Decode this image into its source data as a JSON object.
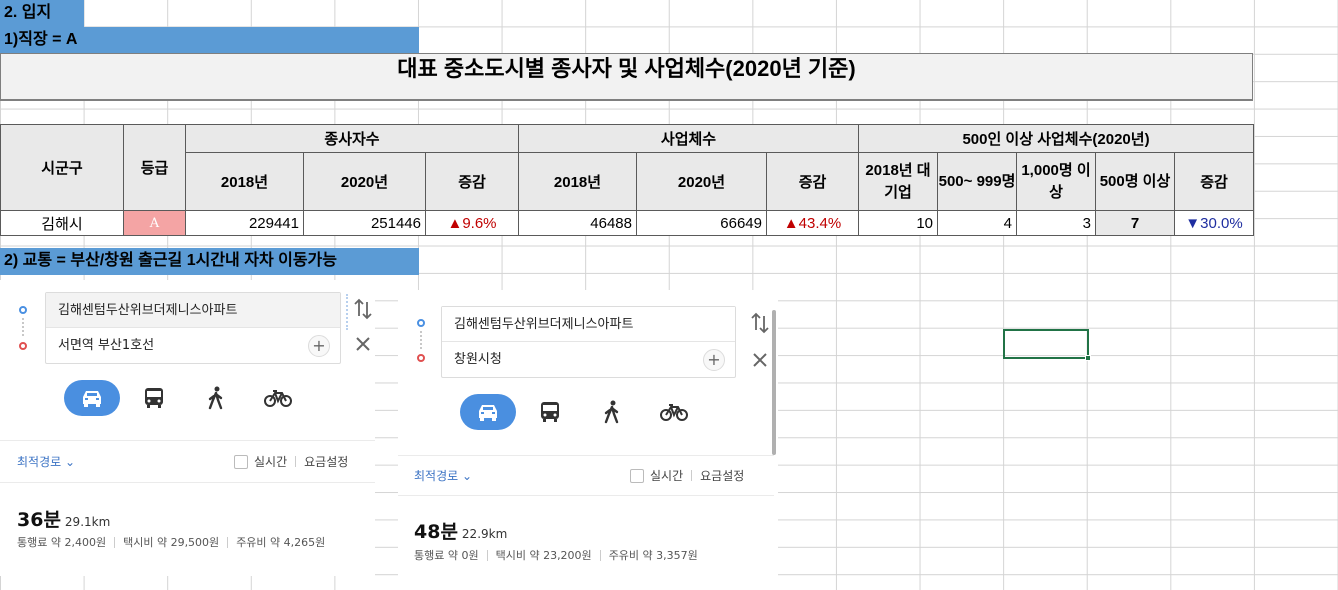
{
  "sheet": {
    "section_title": "2. 입지",
    "sub1_title": "1)직장 = A",
    "sub2_title": "2) 교통 = 부산/창원 출근길 1시간내 자차 이동가능"
  },
  "table": {
    "title": "대표 중소도시별 종사자 및 사업체수(2020년 기준)",
    "headers": {
      "region": "시군구",
      "grade": "등급",
      "workers": "종사자수",
      "businesses": "사업체수",
      "large": "500인 이상 사업체수(2020년)",
      "y2018": "2018년",
      "y2020": "2020년",
      "change": "증감",
      "large_2018": "2018년 대기업",
      "large_500_999": "500~ 999명",
      "large_1000": "1,000명 이상",
      "large_500plus": "500명 이상",
      "large_change": "증감"
    },
    "row": {
      "region": "김해시",
      "grade": "A",
      "workers_2018": "229441",
      "workers_2020": "251446",
      "workers_change": "▲9.6%",
      "biz_2018": "46488",
      "biz_2020": "66649",
      "biz_change": "▲43.4%",
      "large_2018": "10",
      "large_500_999": "4",
      "large_1000": "3",
      "large_500plus": "7",
      "large_change": "▼30.0%"
    }
  },
  "map1": {
    "origin": "김해센텀두산위브더제니스아파트",
    "destination": "서면역 부산1호선",
    "route_option": "최적경로",
    "realtime_label": "실시간",
    "fare_label": "요금설정",
    "time": "36분",
    "distance": "29.1km",
    "toll": "통행료 약 2,400원",
    "taxi": "택시비 약 29,500원",
    "fuel": "주유비 약 4,265원"
  },
  "map2": {
    "origin": "김해센텀두산위브더제니스아파트",
    "destination": "창원시청",
    "route_option": "최적경로",
    "realtime_label": "실시간",
    "fare_label": "요금설정",
    "time": "48분",
    "distance": "22.9km",
    "toll": "통행료 약 0원",
    "taxi": "택시비 약 23,200원",
    "fuel": "주유비 약 3,357원"
  },
  "icons": {
    "car": "car-icon",
    "bus": "bus-icon",
    "walk": "walk-icon",
    "bike": "bike-icon",
    "swap": "swap-icon",
    "close": "close-icon",
    "plus": "plus-icon",
    "chevron": "chevron-down-icon"
  },
  "colors": {
    "header_blue": "#5b9bd5",
    "grade_fill": "#f4a4a4",
    "increase": "#c00000",
    "decrease": "#1f2ea0",
    "active_mode": "#4a8fe0",
    "selection": "#217346"
  }
}
